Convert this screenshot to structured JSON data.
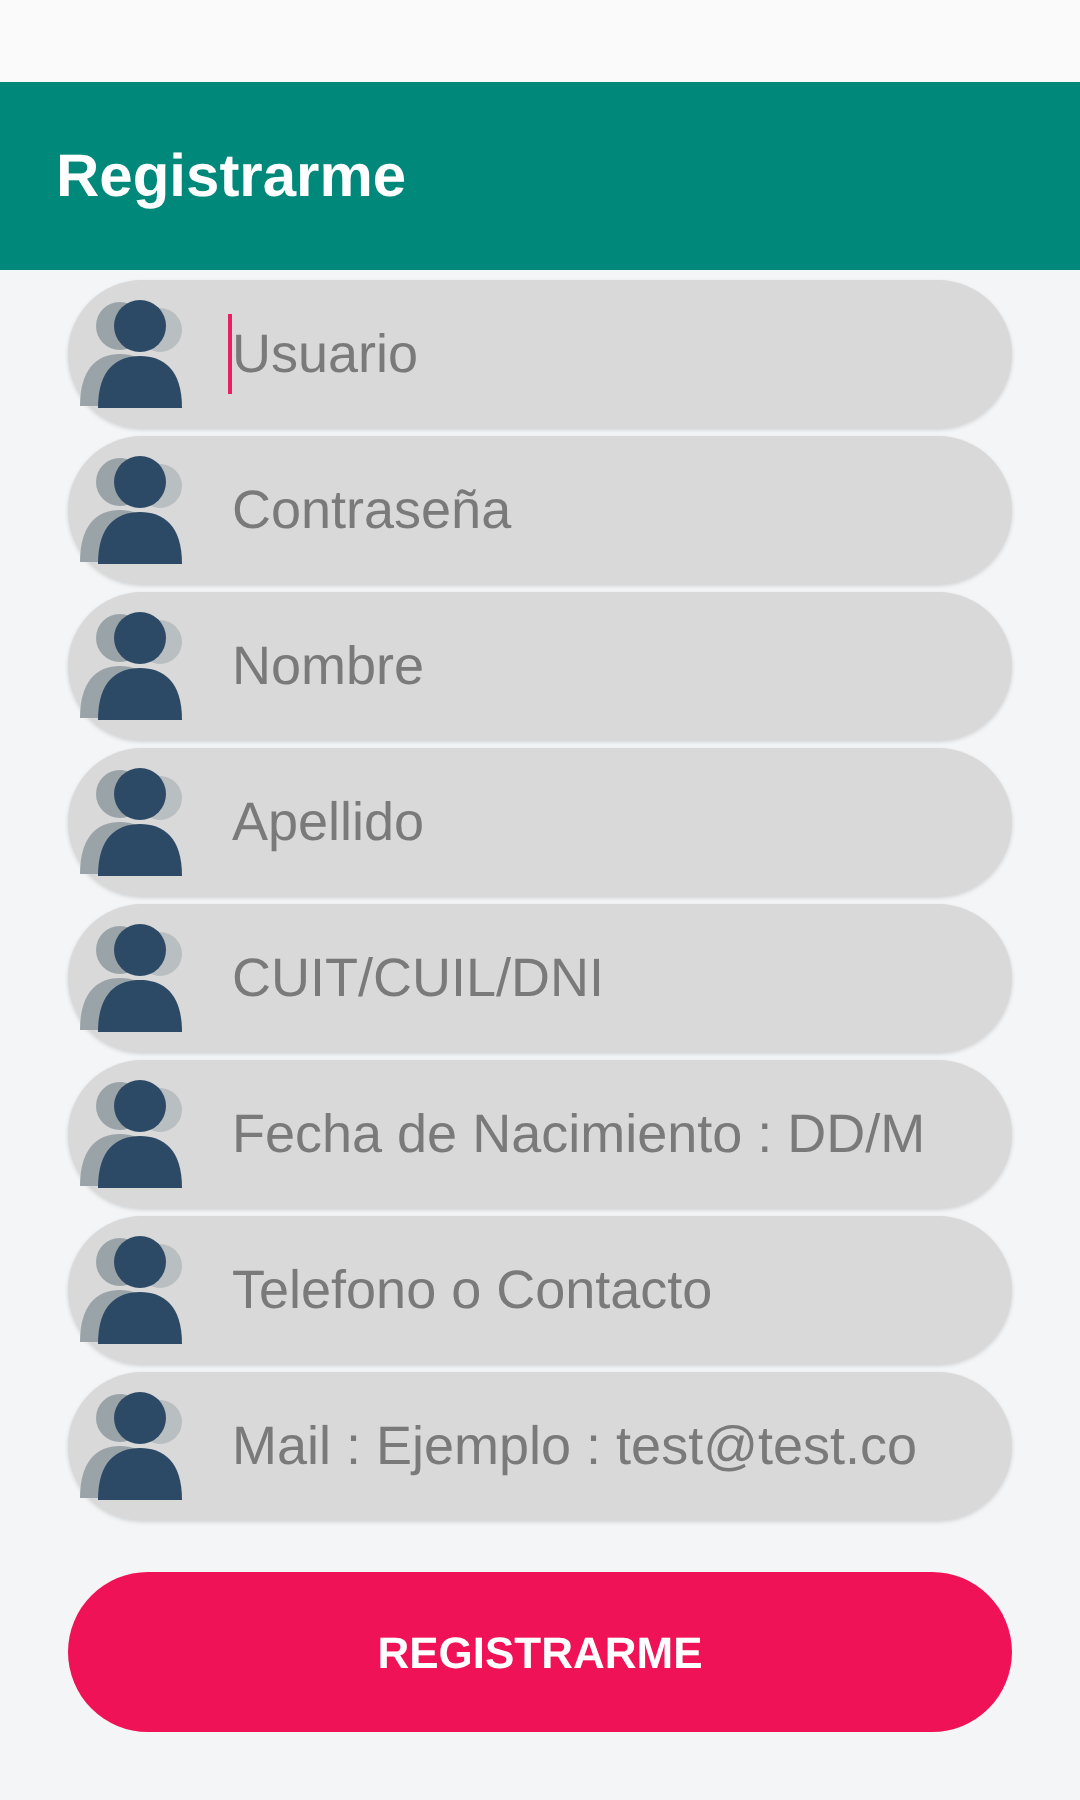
{
  "app_bar": {
    "title": "Registrarme"
  },
  "fields": [
    {
      "placeholder": "Usuario",
      "focused": true
    },
    {
      "placeholder": "Contraseña",
      "focused": false
    },
    {
      "placeholder": "Nombre",
      "focused": false
    },
    {
      "placeholder": "Apellido",
      "focused": false
    },
    {
      "placeholder": "CUIT/CUIL/DNI",
      "focused": false
    },
    {
      "placeholder": "Fecha de Nacimiento : DD/M",
      "focused": false
    },
    {
      "placeholder": "Telefono o Contacto",
      "focused": false
    },
    {
      "placeholder": "Mail : Ejemplo : test@test.co",
      "focused": false
    }
  ],
  "submit_button": "REGISTRARME"
}
